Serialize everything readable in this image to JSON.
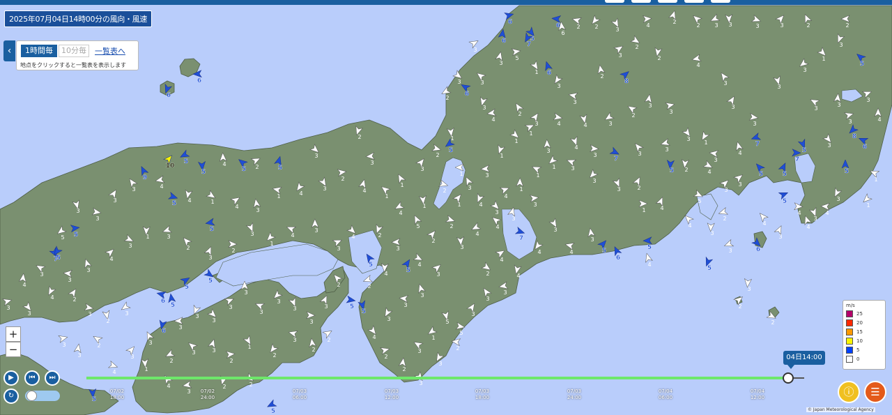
{
  "header": {
    "title": "2025年07月04日14時00分の風向・風速"
  },
  "panel": {
    "toggle_icon": "chevron-left-icon",
    "hourly_label": "1時間毎",
    "tenmin_label": "10分毎",
    "list_link": "一覧表へ",
    "hint": "地点をクリックすると一覧表を表示します"
  },
  "zoom": {
    "in_label": "+",
    "out_label": "−"
  },
  "playback": {
    "play_icon": "play-icon",
    "back_icon": "step-back-icon",
    "forward_icon": "step-forward-icon",
    "refresh_icon": "refresh-icon"
  },
  "timeline": {
    "current_label": "04日14:00",
    "ticks": [
      {
        "date": "07/02",
        "time": "18:00"
      },
      {
        "date": "07/02",
        "time": "24:00"
      },
      {
        "date": "07/03",
        "time": "06:00"
      },
      {
        "date": "07/03",
        "time": "12:00"
      },
      {
        "date": "07/03",
        "time": "18:00"
      },
      {
        "date": "07/03",
        "time": "24:00"
      },
      {
        "date": "07/04",
        "time": "06:00"
      },
      {
        "date": "07/04",
        "time": "12:00"
      }
    ]
  },
  "legend": {
    "unit": "m/s",
    "rows": [
      {
        "label": "25",
        "color": "#b4006a"
      },
      {
        "label": "20",
        "color": "#ff2800"
      },
      {
        "label": "15",
        "color": "#ff9900"
      },
      {
        "label": "10",
        "color": "#faf500"
      },
      {
        "label": "5",
        "color": "#0041ff"
      },
      {
        "label": "0",
        "color": "#ffffff"
      }
    ]
  },
  "buttons": {
    "info_icon": "info-icon",
    "manual_icon": "book-icon"
  },
  "copyright": "© Japan Meteorological Agency",
  "colors": {
    "sea": "#b9cdfb",
    "land": "#7a9070",
    "header": "#1a5fa0",
    "arrow_white": "#ffffff",
    "arrow_blue": "#1f4fd6",
    "arrow_yellow": "#faf500"
  },
  "stations": [
    [
      240,
      127,
      "6",
      "b"
    ],
    [
      284,
      106,
      "6",
      "b"
    ],
    [
      206,
      245,
      "9",
      "b"
    ],
    [
      242,
      228,
      "10",
      "y"
    ],
    [
      248,
      282,
      "5",
      "b"
    ],
    [
      290,
      237,
      "5",
      "b"
    ],
    [
      265,
      222,
      "5",
      "b"
    ],
    [
      348,
      233,
      "5",
      "b"
    ],
    [
      400,
      231,
      "5",
      "b"
    ],
    [
      107,
      327,
      "5",
      "b"
    ],
    [
      78,
      362,
      "7",
      "b"
    ],
    [
      82,
      360,
      "5",
      "b"
    ],
    [
      232,
      422,
      "6",
      "b"
    ],
    [
      246,
      428,
      "5",
      "b"
    ],
    [
      266,
      402,
      "5",
      "b"
    ],
    [
      300,
      393,
      "5",
      "b"
    ],
    [
      233,
      465,
      "6",
      "b"
    ],
    [
      302,
      319,
      "5",
      "b"
    ],
    [
      530,
      370,
      "5",
      "b"
    ],
    [
      584,
      378,
      "5",
      "b"
    ],
    [
      503,
      430,
      "5",
      "b"
    ],
    [
      520,
      437,
      "5",
      "b"
    ],
    [
      645,
      206,
      "5",
      "b"
    ],
    [
      668,
      125,
      "6",
      "b"
    ],
    [
      721,
      49,
      "6",
      "b"
    ],
    [
      730,
      22,
      "6",
      "b"
    ],
    [
      762,
      46,
      "5",
      "b"
    ],
    [
      757,
      54,
      "7",
      "b"
    ],
    [
      799,
      27,
      "6",
      "b"
    ],
    [
      786,
      95,
      "6",
      "b"
    ],
    [
      897,
      107,
      "8",
      "b"
    ],
    [
      882,
      218,
      "7",
      "b"
    ],
    [
      962,
      235,
      "5",
      "b"
    ],
    [
      1085,
      197,
      "7",
      "b"
    ],
    [
      1090,
      240,
      "5",
      "b"
    ],
    [
      1124,
      240,
      "5",
      "b"
    ],
    [
      1142,
      219,
      "7",
      "b"
    ],
    [
      1152,
      206,
      "5",
      "b"
    ],
    [
      1224,
      186,
      "8",
      "b"
    ],
    [
      1239,
      201,
      "6",
      "b"
    ],
    [
      1213,
      236,
      "5",
      "b"
    ],
    [
      1124,
      279,
      "5",
      "b"
    ],
    [
      1086,
      348,
      "6",
      "b"
    ],
    [
      1016,
      375,
      "5",
      "b"
    ],
    [
      930,
      345,
      "5",
      "b"
    ],
    [
      885,
      360,
      "6",
      "b"
    ],
    [
      865,
      350,
      "5",
      "b"
    ],
    [
      746,
      332,
      "7",
      "b"
    ],
    [
      133,
      563,
      "5",
      "b"
    ],
    [
      390,
      580,
      "5",
      "b"
    ],
    [
      1235,
      82,
      "5",
      "b"
    ],
    [
      320,
      226,
      "4",
      "w"
    ],
    [
      367,
      230,
      "2",
      "w"
    ],
    [
      452,
      214,
      "3",
      "w"
    ],
    [
      514,
      187,
      "2",
      "w"
    ],
    [
      532,
      224,
      "3",
      "w"
    ],
    [
      575,
      256,
      "1",
      "w"
    ],
    [
      604,
      233,
      "3",
      "w"
    ],
    [
      626,
      213,
      "2",
      "w"
    ],
    [
      647,
      189,
      "1",
      "w"
    ],
    [
      640,
      131,
      "2",
      "w"
    ],
    [
      690,
      109,
      "3",
      "w"
    ],
    [
      717,
      81,
      "3",
      "w"
    ],
    [
      740,
      74,
      "5",
      "w"
    ],
    [
      768,
      94,
      "1",
      "w"
    ],
    [
      800,
      114,
      "3",
      "w"
    ],
    [
      823,
      137,
      "3",
      "w"
    ],
    [
      862,
      100,
      "2",
      "w"
    ],
    [
      888,
      70,
      "3",
      "w"
    ],
    [
      912,
      58,
      "2",
      "w"
    ],
    [
      944,
      74,
      "2",
      "w"
    ],
    [
      1000,
      84,
      "4",
      "w"
    ],
    [
      1039,
      110,
      "3",
      "w"
    ],
    [
      1050,
      144,
      "3",
      "w"
    ],
    [
      1081,
      168,
      "3",
      "w"
    ],
    [
      1116,
      115,
      "3",
      "w"
    ],
    [
      1153,
      91,
      "3",
      "w"
    ],
    [
      1169,
      146,
      "3",
      "w"
    ],
    [
      1202,
      141,
      "3",
      "w"
    ],
    [
      1218,
      165,
      "3",
      "w"
    ],
    [
      1188,
      199,
      "3",
      "w"
    ],
    [
      1201,
      276,
      "3",
      "w"
    ],
    [
      1185,
      296,
      "4",
      "w"
    ],
    [
      1158,
      316,
      "4",
      "w"
    ],
    [
      1040,
      263,
      "3",
      "w"
    ],
    [
      1002,
      279,
      "5",
      "w"
    ],
    [
      1020,
      325,
      "3",
      "w"
    ],
    [
      1046,
      350,
      "3",
      "w"
    ],
    [
      988,
      314,
      "4",
      "w"
    ],
    [
      948,
      289,
      "4",
      "w"
    ],
    [
      922,
      292,
      "1",
      "w"
    ],
    [
      886,
      262,
      "3",
      "w"
    ],
    [
      851,
      250,
      "3",
      "w"
    ],
    [
      820,
      232,
      "3",
      "w"
    ],
    [
      785,
      207,
      "3",
      "w"
    ],
    [
      760,
      182,
      "1",
      "w"
    ],
    [
      739,
      193,
      "1",
      "w"
    ],
    [
      718,
      214,
      "1",
      "w"
    ],
    [
      697,
      242,
      "3",
      "w"
    ],
    [
      672,
      260,
      "3",
      "w"
    ],
    [
      657,
      284,
      "1",
      "w"
    ],
    [
      636,
      264,
      "2",
      "w"
    ],
    [
      607,
      286,
      "1",
      "w"
    ],
    [
      573,
      296,
      "4",
      "w"
    ],
    [
      553,
      272,
      "1",
      "w"
    ],
    [
      521,
      264,
      "4",
      "w"
    ],
    [
      490,
      247,
      "2",
      "w"
    ],
    [
      464,
      261,
      "3",
      "w"
    ],
    [
      430,
      268,
      "4",
      "w"
    ],
    [
      398,
      272,
      "1",
      "w"
    ],
    [
      368,
      292,
      "3",
      "w"
    ],
    [
      338,
      287,
      "4",
      "w"
    ],
    [
      303,
      280,
      "1",
      "w"
    ],
    [
      270,
      278,
      "4",
      "w"
    ],
    [
      230,
      258,
      "4",
      "w"
    ],
    [
      190,
      262,
      "3",
      "w"
    ],
    [
      163,
      278,
      "3",
      "w"
    ],
    [
      138,
      304,
      "3",
      "w"
    ],
    [
      110,
      293,
      "3",
      "w"
    ],
    [
      88,
      331,
      "5",
      "w"
    ],
    [
      58,
      384,
      "3",
      "w"
    ],
    [
      33,
      399,
      "4",
      "w"
    ],
    [
      10,
      432,
      "3",
      "w"
    ],
    [
      40,
      440,
      "3",
      "w"
    ],
    [
      73,
      417,
      "4",
      "w"
    ],
    [
      98,
      392,
      "3",
      "w"
    ],
    [
      125,
      378,
      "3",
      "w"
    ],
    [
      158,
      362,
      "4",
      "w"
    ],
    [
      185,
      343,
      "3",
      "w"
    ],
    [
      210,
      330,
      "1",
      "w"
    ],
    [
      240,
      330,
      "3",
      "w"
    ],
    [
      268,
      346,
      "2",
      "w"
    ],
    [
      300,
      360,
      "3",
      "w"
    ],
    [
      333,
      350,
      "2",
      "w"
    ],
    [
      360,
      326,
      "3",
      "w"
    ],
    [
      388,
      340,
      "1",
      "w"
    ],
    [
      418,
      328,
      "4",
      "w"
    ],
    [
      452,
      321,
      "3",
      "w"
    ],
    [
      484,
      347,
      "3",
      "w"
    ],
    [
      505,
      330,
      "4",
      "w"
    ],
    [
      543,
      328,
      "2",
      "w"
    ],
    [
      569,
      347,
      "3",
      "w"
    ],
    [
      598,
      315,
      "5",
      "w"
    ],
    [
      620,
      336,
      "2",
      "w"
    ],
    [
      646,
      315,
      "2",
      "w"
    ],
    [
      661,
      345,
      "3",
      "w"
    ],
    [
      683,
      326,
      "4",
      "w"
    ],
    [
      712,
      316,
      "4",
      "w"
    ],
    [
      735,
      304,
      "3",
      "w"
    ],
    [
      766,
      284,
      "3",
      "w"
    ],
    [
      795,
      320,
      "3",
      "w"
    ],
    [
      772,
      352,
      "4",
      "w"
    ],
    [
      818,
      352,
      "4",
      "w"
    ],
    [
      848,
      334,
      "3",
      "w"
    ],
    [
      718,
      363,
      "4",
      "w"
    ],
    [
      698,
      383,
      "2",
      "w"
    ],
    [
      742,
      386,
      "4",
      "w"
    ],
    [
      723,
      410,
      "3",
      "w"
    ],
    [
      698,
      419,
      "3",
      "w"
    ],
    [
      677,
      441,
      "3",
      "w"
    ],
    [
      660,
      468,
      "5",
      "w"
    ],
    [
      640,
      452,
      "5",
      "w"
    ],
    [
      620,
      475,
      "1",
      "w"
    ],
    [
      600,
      494,
      "3",
      "w"
    ],
    [
      578,
      520,
      "2",
      "w"
    ],
    [
      552,
      502,
      "2",
      "w"
    ],
    [
      535,
      474,
      "4",
      "w"
    ],
    [
      556,
      448,
      "3",
      "w"
    ],
    [
      580,
      428,
      "3",
      "w"
    ],
    [
      604,
      414,
      "3",
      "w"
    ],
    [
      627,
      384,
      "3",
      "w"
    ],
    [
      600,
      370,
      "4",
      "w"
    ],
    [
      552,
      383,
      "4",
      "w"
    ],
    [
      528,
      401,
      "2",
      "w"
    ],
    [
      484,
      399,
      "2",
      "w"
    ],
    [
      466,
      430,
      "3",
      "w"
    ],
    [
      445,
      452,
      "3",
      "w"
    ],
    [
      421,
      433,
      "3",
      "w"
    ],
    [
      398,
      423,
      "3",
      "w"
    ],
    [
      373,
      438,
      "3",
      "w"
    ],
    [
      351,
      410,
      "3",
      "w"
    ],
    [
      329,
      431,
      "3",
      "w"
    ],
    [
      305,
      450,
      "3",
      "w"
    ],
    [
      281,
      444,
      "3",
      "w"
    ],
    [
      257,
      460,
      "3",
      "w"
    ],
    [
      214,
      482,
      "3",
      "w"
    ],
    [
      188,
      502,
      "3",
      "w"
    ],
    [
      162,
      524,
      "4",
      "w"
    ],
    [
      208,
      520,
      "1",
      "w"
    ],
    [
      244,
      508,
      "2",
      "w"
    ],
    [
      276,
      496,
      "3",
      "w"
    ],
    [
      305,
      493,
      "3",
      "w"
    ],
    [
      330,
      508,
      "2",
      "w"
    ],
    [
      356,
      488,
      "1",
      "w"
    ],
    [
      392,
      500,
      "2",
      "w"
    ],
    [
      421,
      478,
      "3",
      "w"
    ],
    [
      448,
      492,
      "2",
      "w"
    ],
    [
      470,
      478,
      "2",
      "w"
    ],
    [
      358,
      542,
      "2",
      "w"
    ],
    [
      320,
      545,
      "2",
      "w"
    ],
    [
      269,
      552,
      "3",
      "w"
    ],
    [
      240,
      544,
      "4",
      "w"
    ],
    [
      105,
      420,
      "2",
      "w"
    ],
    [
      127,
      441,
      "3",
      "w"
    ],
    [
      153,
      451,
      "2",
      "w"
    ],
    [
      180,
      440,
      "3",
      "w"
    ],
    [
      140,
      486,
      "2",
      "w"
    ],
    [
      112,
      500,
      "3",
      "w"
    ],
    [
      90,
      485,
      "3",
      "w"
    ],
    [
      602,
      540,
      "3",
      "w"
    ],
    [
      630,
      512,
      "3",
      "w"
    ],
    [
      655,
      490,
      "2",
      "w"
    ],
    [
      930,
      370,
      "4",
      "w"
    ],
    [
      1060,
      430,
      "2",
      "w"
    ],
    [
      1107,
      453,
      "2",
      "w"
    ],
    [
      1073,
      405,
      "3",
      "w"
    ],
    [
      1038,
      304,
      "2",
      "w"
    ],
    [
      1095,
      311,
      "4",
      "w"
    ],
    [
      1118,
      330,
      "3",
      "w"
    ],
    [
      1145,
      296,
      "4",
      "w"
    ],
    [
      1168,
      304,
      "3",
      "w"
    ],
    [
      1244,
      285,
      "1",
      "w"
    ],
    [
      1255,
      248,
      "1",
      "w"
    ],
    [
      1260,
      162,
      "4",
      "w"
    ],
    [
      1244,
      134,
      "3",
      "w"
    ],
    [
      1180,
      75,
      "1",
      "w"
    ],
    [
      1205,
      55,
      "3",
      "w"
    ],
    [
      1214,
      27,
      "2",
      "w"
    ],
    [
      1158,
      27,
      "2",
      "w"
    ],
    [
      1120,
      27,
      "3",
      "w"
    ],
    [
      1085,
      28,
      "3",
      "w"
    ],
    [
      1046,
      26,
      "3",
      "w"
    ],
    [
      1026,
      27,
      "3",
      "w"
    ],
    [
      1000,
      27,
      "2",
      "w"
    ],
    [
      966,
      22,
      "2",
      "w"
    ],
    [
      928,
      27,
      "4",
      "w"
    ],
    [
      884,
      33,
      "3",
      "w"
    ],
    [
      854,
      29,
      "2",
      "w"
    ],
    [
      828,
      29,
      "2",
      "w"
    ],
    [
      806,
      38,
      "6",
      "w"
    ],
    [
      680,
      62,
      "3",
      "w"
    ],
    [
      657,
      108,
      "3",
      "w"
    ],
    [
      693,
      145,
      "3",
      "w"
    ],
    [
      706,
      162,
      "4",
      "w"
    ],
    [
      744,
      154,
      "2",
      "w"
    ],
    [
      768,
      168,
      "3",
      "w"
    ],
    [
      800,
      168,
      "4",
      "w"
    ],
    [
      838,
      170,
      "4",
      "w"
    ],
    [
      874,
      168,
      "3",
      "w"
    ],
    [
      907,
      156,
      "2",
      "w"
    ],
    [
      931,
      142,
      "3",
      "w"
    ],
    [
      961,
      151,
      "3",
      "w"
    ],
    [
      986,
      190,
      "3",
      "w"
    ],
    [
      1011,
      195,
      "1",
      "w"
    ],
    [
      1025,
      220,
      "3",
      "w"
    ],
    [
      1060,
      210,
      "4",
      "w"
    ],
    [
      1060,
      255,
      "3",
      "w"
    ],
    [
      1016,
      237,
      "4",
      "w"
    ],
    [
      983,
      234,
      "2",
      "w"
    ],
    [
      955,
      205,
      "3",
      "w"
    ],
    [
      916,
      211,
      "3",
      "w"
    ],
    [
      915,
      260,
      "2",
      "w"
    ],
    [
      852,
      213,
      "3",
      "w"
    ],
    [
      825,
      202,
      "4",
      "w"
    ],
    [
      793,
      230,
      "1",
      "w"
    ],
    [
      770,
      242,
      "1",
      "w"
    ],
    [
      746,
      262,
      "1",
      "w"
    ],
    [
      724,
      272,
      "4",
      "w"
    ],
    [
      711,
      295,
      "3",
      "w"
    ],
    [
      688,
      284,
      "4",
      "w"
    ],
    [
      660,
      240,
      "1",
      "w"
    ]
  ]
}
